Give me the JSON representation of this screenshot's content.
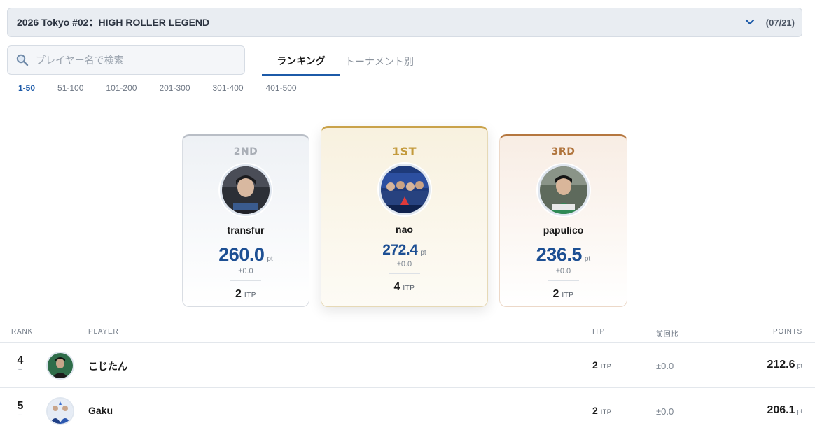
{
  "tournament": {
    "title": "2026 Tokyo #02：HIGH ROLLER LEGEND",
    "date": "(07/21)",
    "chevron_icon": "chevron-down-icon"
  },
  "search": {
    "placeholder": "プレイヤー名で検索",
    "value": "",
    "icon": "search-icon"
  },
  "tabs": [
    {
      "label": "ランキング",
      "active": true
    },
    {
      "label": "トーナメント別",
      "active": false
    }
  ],
  "ranges": [
    {
      "label": "1-50",
      "active": true
    },
    {
      "label": "51-100",
      "active": false
    },
    {
      "label": "101-200",
      "active": false
    },
    {
      "label": "201-300",
      "active": false
    },
    {
      "label": "301-400",
      "active": false
    },
    {
      "label": "401-500",
      "active": false
    }
  ],
  "podium": {
    "second": {
      "place": "2ND",
      "name": "transfur",
      "points": "260.0",
      "points_unit": "pt",
      "diff": "±0.0",
      "itp": "2",
      "itp_unit": "ITP"
    },
    "first": {
      "place": "1ST",
      "name": "nao",
      "points": "272.4",
      "points_unit": "pt",
      "diff": "±0.0",
      "itp": "4",
      "itp_unit": "ITP"
    },
    "third": {
      "place": "3RD",
      "name": "papulico",
      "points": "236.5",
      "points_unit": "pt",
      "diff": "±0.0",
      "itp": "2",
      "itp_unit": "ITP"
    }
  },
  "table": {
    "headers": {
      "rank": "RANK",
      "player": "PLAYER",
      "itp": "ITP",
      "change": "前回比",
      "points": "POINTS"
    },
    "rows": [
      {
        "rank": "4",
        "rank_change": "–",
        "name": "こじたん",
        "itp": "2",
        "itp_unit": "ITP",
        "change": "±0.0",
        "points": "212.6",
        "points_unit": "pt"
      },
      {
        "rank": "5",
        "rank_change": "–",
        "name": "Gaku",
        "itp": "2",
        "itp_unit": "ITP",
        "change": "±0.0",
        "points": "206.1",
        "points_unit": "pt"
      }
    ]
  },
  "colors": {
    "accent": "#1c5aa8",
    "points": "#1d4f93",
    "gold": "#c39a3c",
    "silver": "#a9aeb6",
    "bronze": "#b0743c"
  }
}
